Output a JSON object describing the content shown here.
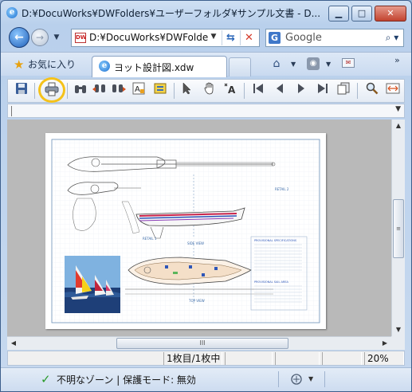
{
  "window": {
    "title": "D:¥DocuWorks¥DWFolders¥ユーザーフォルダ¥サンプル文書 - D..."
  },
  "nav": {
    "address": "D:¥DocuWorks¥DWFolde",
    "search_placeholder": "Google",
    "search_engine_icon": "G"
  },
  "tabs": {
    "favorites_label": "お気に入り",
    "active_tab_label": "ヨット設計図.xdw"
  },
  "toolbar": {
    "icons": [
      "save-icon",
      "print-icon",
      "binoculars-icon",
      "binoculars-prev-icon",
      "binoculars-next-icon",
      "text-search-icon",
      "annotation-icon",
      "select-pointer-icon",
      "hand-icon",
      "text-select-icon",
      "first-page-icon",
      "prev-page-icon",
      "next-page-icon",
      "last-page-icon",
      "pages-icon",
      "zoom-icon",
      "fit-width-icon"
    ],
    "highlight_color": "#f5c21a"
  },
  "drawing": {
    "text_boat_deck": "RETAIL 1",
    "text_side_view": "SIDE VIEW",
    "text_top_view": "TOP VIEW",
    "text_retail2": "RETAIL 2",
    "spec_title": "PROVISIONAL SPECIFICATIONS",
    "sail_title": "PROVISIONAL SAIL AREA"
  },
  "status": {
    "page_indicator": "1枚目/1枚中",
    "zoom": "20%"
  },
  "ie_status": {
    "zone_text": "不明なゾーン | 保護モード: 無効"
  },
  "colors": {
    "accent": "#1b6fd0",
    "hull_stripe_red": "#c9234b",
    "hull_stripe_blue": "#2d56b8",
    "hull_stripe_purple": "#8a3cb8"
  }
}
